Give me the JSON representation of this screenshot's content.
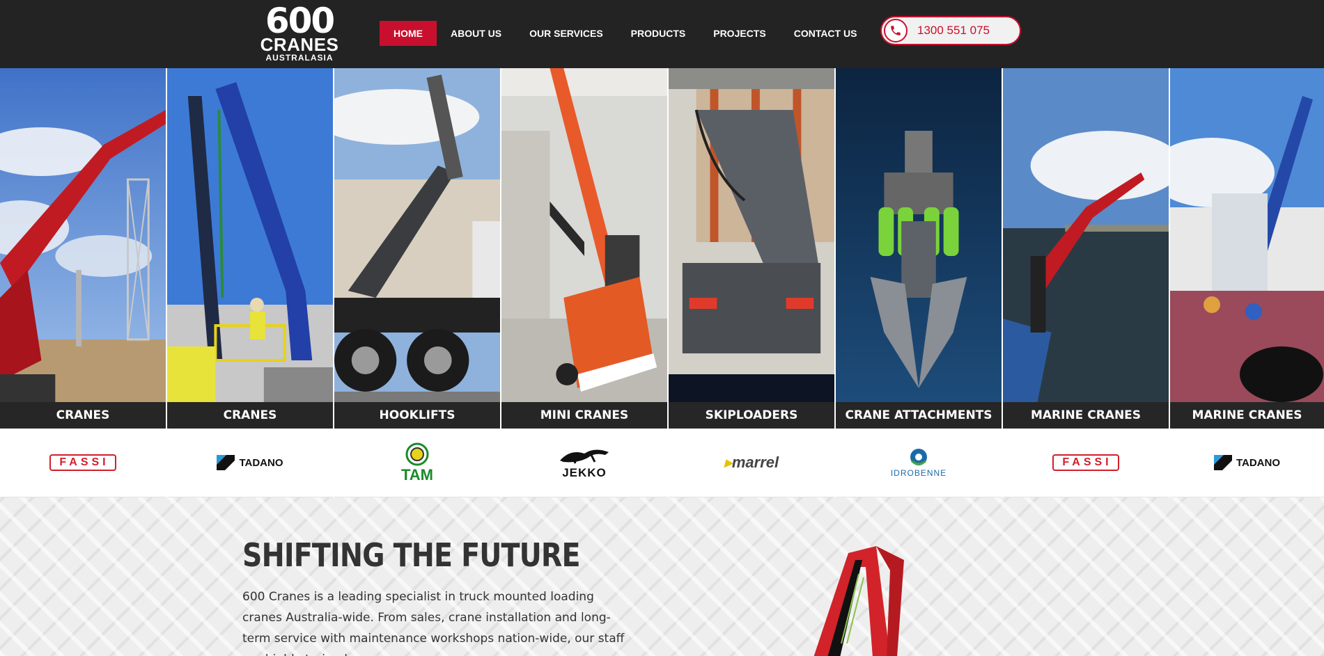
{
  "logo": {
    "number": "600",
    "word": "CRANES",
    "sub": "AUSTRALASIA"
  },
  "nav": [
    {
      "label": "HOME",
      "active": true
    },
    {
      "label": "ABOUT US"
    },
    {
      "label": "OUR SERVICES"
    },
    {
      "label": "PRODUCTS"
    },
    {
      "label": "PROJECTS"
    },
    {
      "label": "CONTACT US"
    }
  ],
  "phone": {
    "number": "1300 551 075",
    "icon": "phone-icon"
  },
  "products": [
    {
      "caption": "CRANES",
      "brand": "FASSI"
    },
    {
      "caption": "CRANES",
      "brand": "TADANO"
    },
    {
      "caption": "HOOKLIFTS",
      "brand": "TAM"
    },
    {
      "caption": "MINI CRANES",
      "brand": "JEKKO"
    },
    {
      "caption": "SKIPLOADERS",
      "brand": "marrel"
    },
    {
      "caption": "CRANE ATTACHMENTS",
      "brand": "IDROBENNE"
    },
    {
      "caption": "MARINE CRANES",
      "brand": "FASSI"
    },
    {
      "caption": "MARINE CRANES",
      "brand": "TADANO"
    }
  ],
  "intro": {
    "headline": "SHIFTING THE FUTURE",
    "text": "600 Cranes is a leading specialist in truck mounted loading cranes Australia-wide. From sales, crane installation and long-term service with maintenance workshops nation-wide, our staff are highly trained"
  },
  "colors": {
    "accent": "#c8102e",
    "header_bg": "#232323",
    "caption_bg": "#262626"
  }
}
